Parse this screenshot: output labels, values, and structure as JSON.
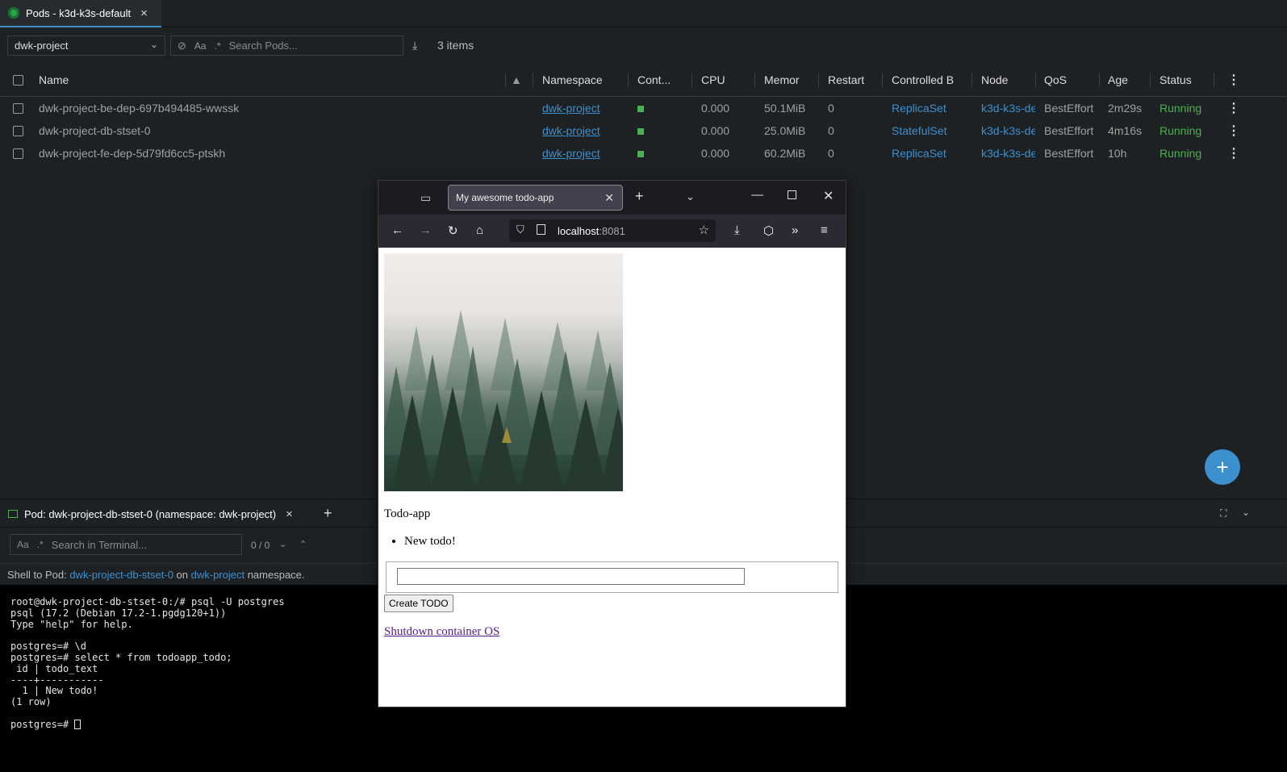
{
  "top_tab": {
    "title": "Pods - k3d-k3s-default",
    "close": "×"
  },
  "toolbar": {
    "namespace": "dwk-project",
    "search_placeholder": "Search Pods...",
    "items_count": "3 items",
    "case_toggle": "Aa",
    "regex_toggle": ".*"
  },
  "table": {
    "headers": {
      "name": "Name",
      "namespace": "Namespace",
      "containers": "Cont...",
      "cpu": "CPU",
      "memory": "Memor",
      "restarts": "Restart",
      "controlled_by": "Controlled B",
      "node": "Node",
      "qos": "QoS",
      "age": "Age",
      "status": "Status"
    },
    "rows": [
      {
        "name": "dwk-project-be-dep-697b494485-wwssk",
        "namespace": "dwk-project",
        "cpu": "0.000",
        "memory": "50.1MiB",
        "restarts": "0",
        "controlled_by": "ReplicaSet",
        "node": "k3d-k3s-de",
        "qos": "BestEffort",
        "age": "2m29s",
        "status": "Running"
      },
      {
        "name": "dwk-project-db-stset-0",
        "namespace": "dwk-project",
        "cpu": "0.000",
        "memory": "25.0MiB",
        "restarts": "0",
        "controlled_by": "StatefulSet",
        "node": "k3d-k3s-de",
        "qos": "BestEffort",
        "age": "4m16s",
        "status": "Running"
      },
      {
        "name": "dwk-project-fe-dep-5d79fd6cc5-ptskh",
        "namespace": "dwk-project",
        "cpu": "0.000",
        "memory": "60.2MiB",
        "restarts": "0",
        "controlled_by": "ReplicaSet",
        "node": "k3d-k3s-de",
        "qos": "BestEffort",
        "age": "10h",
        "status": "Running"
      }
    ]
  },
  "fab": "+",
  "dock": {
    "tab_title": "Pod: dwk-project-db-stset-0 (namespace: dwk-project)",
    "search_placeholder": "Search in Terminal...",
    "match_count": "0 / 0",
    "shell_prefix": "Shell to Pod: ",
    "shell_pod": "dwk-project-db-stset-0",
    "shell_on": " on ",
    "shell_ns": "dwk-project",
    "shell_suffix": " namespace."
  },
  "terminal": {
    "lines": [
      "root@dwk-project-db-stset-0:/# psql -U postgres",
      "psql (17.2 (Debian 17.2-1.pgdg120+1))",
      "Type \"help\" for help.",
      "",
      "postgres=# \\d",
      "postgres=# select * from todoapp_todo;",
      " id | todo_text",
      "----+-----------",
      "  1 | New todo!",
      "(1 row)",
      "",
      "postgres=# "
    ]
  },
  "browser": {
    "tab_title": "My awesome todo-app",
    "url_host": "localhost",
    "url_port": ":8081",
    "page": {
      "heading": "Todo-app",
      "todos": [
        "New todo!"
      ],
      "input_value": "",
      "create_button": "Create TODO",
      "shutdown_link": "Shutdown container OS"
    }
  }
}
